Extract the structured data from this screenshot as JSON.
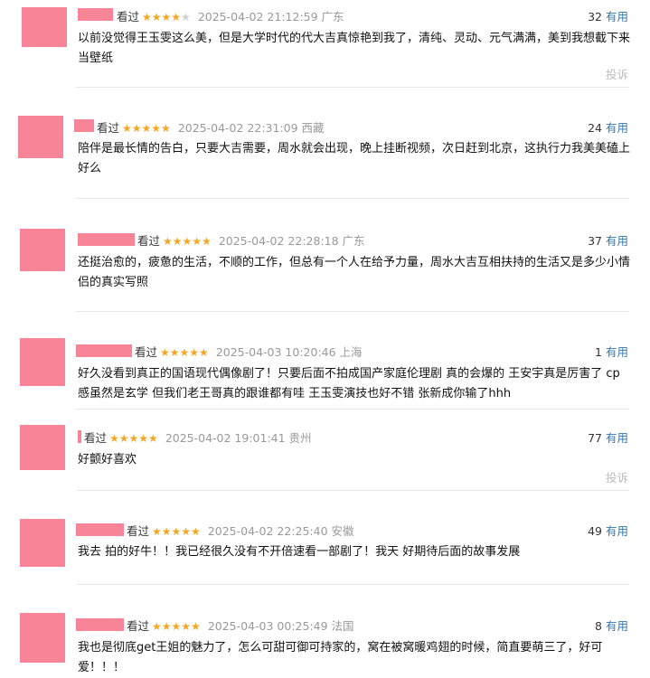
{
  "colors": {
    "avatar": "#f78597",
    "star": "#f5a623",
    "link": "#3377aa",
    "time": "#999999",
    "report": "#bbbbbb"
  },
  "reviews": [
    {
      "seen": "看过",
      "stars": 4,
      "star_text": "★★★★",
      "empty_text": "★",
      "time": "2025-04-02 21:12:59 广东",
      "count": "32",
      "useful": "有用",
      "content": "以前没觉得王玉雯这么美，但是大学时代的代大吉真惊艳到我了，清纯、灵动、元气满满，美到我想截下来当壁纸",
      "report": "投诉"
    },
    {
      "seen": "看过",
      "stars": 5,
      "star_text": "★★★★★",
      "time": "2025-04-02 22:31:09 西藏",
      "count": "24",
      "useful": "有用",
      "content": "陪伴是最长情的告白，只要大吉需要，周水就会出现，晚上挂断视频，次日赶到北京，这执行力我美美磕上好么"
    },
    {
      "seen": "看过",
      "stars": 5,
      "star_text": "★★★★★",
      "time": "2025-04-02 22:28:18 广东",
      "count": "37",
      "useful": "有用",
      "content": "还挺治愈的，疲惫的生活，不顺的工作，但总有一个人在给予力量，周水大吉互相扶持的生活又是多少小情侣的真实写照"
    },
    {
      "seen": "看过",
      "stars": 5,
      "star_text": "★★★★★",
      "time": "2025-04-03 10:20:46 上海",
      "count": "1",
      "useful": "有用",
      "content": "好久没看到真正的国语现代偶像剧了！只要后面不拍成国产家庭伦理剧 真的会爆的 王安宇真是厉害了 cp感虽然是玄学 但我们老王哥真的跟谁都有哇 王玉雯演技也好不错 张新成你输了hhh"
    },
    {
      "seen": "看过",
      "stars": 5,
      "star_text": "★★★★★",
      "time": "2025-04-02 19:01:41 贵州",
      "count": "77",
      "useful": "有用",
      "content": "好颤好喜欢",
      "report": "投诉"
    },
    {
      "seen": "看过",
      "stars": 5,
      "star_text": "★★★★★",
      "time": "2025-04-02 22:25:40 安徽",
      "count": "49",
      "useful": "有用",
      "content": "我去 拍的好牛！！我已经很久没有不开倍速看一部剧了！我天 好期待后面的故事发展"
    },
    {
      "seen": "看过",
      "stars": 5,
      "star_text": "★★★★★",
      "time": "2025-04-03 00:25:49 法国",
      "count": "8",
      "useful": "有用",
      "content": "我也是彻底get王姐的魅力了，怎么可甜可御可持家的，窝在被窝暖鸡翅的时候，简直要萌三了，好可爱！！！"
    }
  ]
}
